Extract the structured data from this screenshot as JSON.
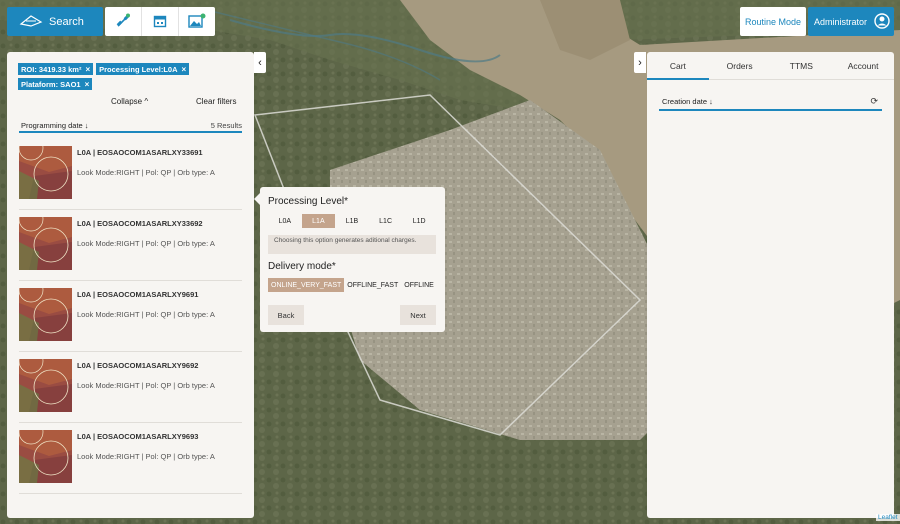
{
  "topbar": {
    "search_label": "Search",
    "tools": [
      "satellite-icon",
      "calendar-icon",
      "image-add-icon"
    ],
    "routine_label": "Routine Mode",
    "admin_label": "Administrator"
  },
  "left_panel": {
    "filters": [
      {
        "label": "ROI: 3419.33 km²",
        "close": "×"
      },
      {
        "label": "Processing Level:L0A",
        "close": "×"
      },
      {
        "label": "Plataform: SAO1",
        "close": "×"
      }
    ],
    "collapse_label": "Collapse ^",
    "clear_label": "Clear filters",
    "sort_label": "Programming date ↓",
    "results_count": "5 Results",
    "results": [
      {
        "title": "L0A | EOSAOCOM1ASARLXY33691",
        "meta": "Look Mode:RIGHT | Pol: QP | Orb type: A"
      },
      {
        "title": "L0A | EOSAOCOM1ASARLXY33692",
        "meta": "Look Mode:RIGHT | Pol: QP | Orb type: A"
      },
      {
        "title": "L0A | EOSAOCOM1ASARLXY9691",
        "meta": "Look Mode:RIGHT | Pol: QP | Orb type: A"
      },
      {
        "title": "L0A | EOSAOCOM1ASARLXY9692",
        "meta": "Look Mode:RIGHT | Pol: QP | Orb type: A"
      },
      {
        "title": "L0A | EOSAOCOM1ASARLXY9693",
        "meta": "Look Mode:RIGHT | Pol: QP | Orb type: A"
      }
    ],
    "collapse_arrow": "‹"
  },
  "popup": {
    "processing_title": "Processing Level*",
    "levels": [
      "L0A",
      "L1A",
      "L1B",
      "L1C",
      "L1D"
    ],
    "selected_level": "L1A",
    "note": "Choosing this option generates aditional charges.",
    "delivery_title": "Delivery mode*",
    "modes": [
      "ONLINE_VERY_FAST",
      "OFFLINE_FAST",
      "OFFLINE"
    ],
    "selected_mode": "ONLINE_VERY_FAST",
    "back_label": "Back",
    "next_label": "Next"
  },
  "right_panel": {
    "expand_arrow": "›",
    "tabs": [
      "Cart",
      "Orders",
      "TTMS",
      "Account"
    ],
    "active_tab": "Cart",
    "sort_label": "Creation date ↓",
    "refresh_icon": "⟳"
  },
  "map": {
    "attribution": "Leaflet"
  },
  "colors": {
    "accent": "#1d87bd",
    "selected": "#c4a48c",
    "panel": "#f7f5f2"
  }
}
